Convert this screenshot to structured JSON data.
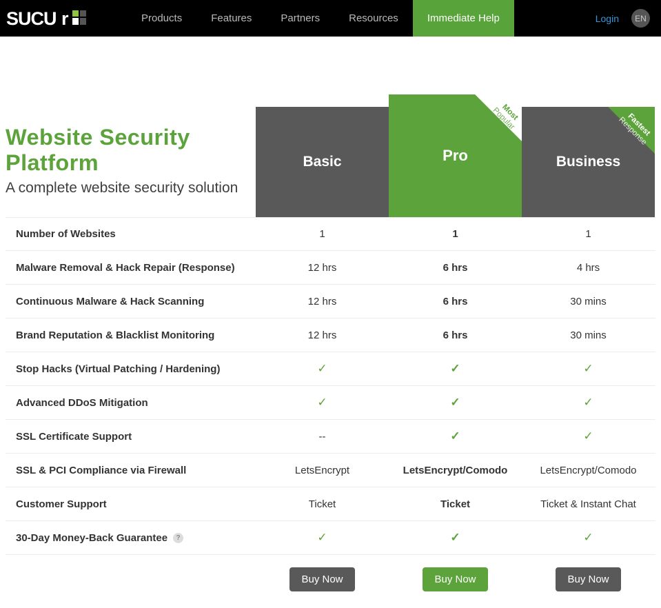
{
  "nav": {
    "items": [
      "Products",
      "Features",
      "Partners",
      "Resources",
      "Immediate Help"
    ],
    "active_index": 4,
    "login": "Login",
    "lang": "EN"
  },
  "intro": {
    "title": "Website Security Platform",
    "subtitle": "A complete website security solution"
  },
  "plans": [
    {
      "name": "Basic",
      "ribbon": null
    },
    {
      "name": "Pro",
      "ribbon": {
        "line1": "Most",
        "line2": "Popular"
      },
      "ribbon_style": "lightgreen",
      "featured": true
    },
    {
      "name": "Business",
      "ribbon": {
        "line1": "Fastest",
        "line2": "Response"
      },
      "ribbon_style": "green"
    }
  ],
  "features": [
    {
      "label": "Number of Websites",
      "values": [
        "1",
        "1",
        "1"
      ]
    },
    {
      "label": "Malware Removal & Hack Repair (Response)",
      "values": [
        "12 hrs",
        "6 hrs",
        "4 hrs"
      ]
    },
    {
      "label": "Continuous Malware & Hack Scanning",
      "values": [
        "12 hrs",
        "6 hrs",
        "30 mins"
      ]
    },
    {
      "label": "Brand Reputation & Blacklist Monitoring",
      "values": [
        "12 hrs",
        "6 hrs",
        "30 mins"
      ]
    },
    {
      "label": "Stop Hacks (Virtual Patching / Hardening)",
      "values": [
        "✓",
        "✓",
        "✓"
      ]
    },
    {
      "label": "Advanced DDoS Mitigation",
      "values": [
        "✓",
        "✓",
        "✓"
      ]
    },
    {
      "label": "SSL Certificate Support",
      "values": [
        "--",
        "✓",
        "✓"
      ]
    },
    {
      "label": "SSL & PCI Compliance via Firewall",
      "values": [
        "LetsEncrypt",
        "LetsEncrypt/Comodo",
        "LetsEncrypt/Comodo"
      ]
    },
    {
      "label": "Customer Support",
      "values": [
        "Ticket",
        "Ticket",
        "Ticket & Instant Chat"
      ]
    },
    {
      "label": "30-Day Money-Back Guarantee",
      "values": [
        "✓",
        "✓",
        "✓"
      ],
      "help": true
    }
  ],
  "buy_label": "Buy Now"
}
